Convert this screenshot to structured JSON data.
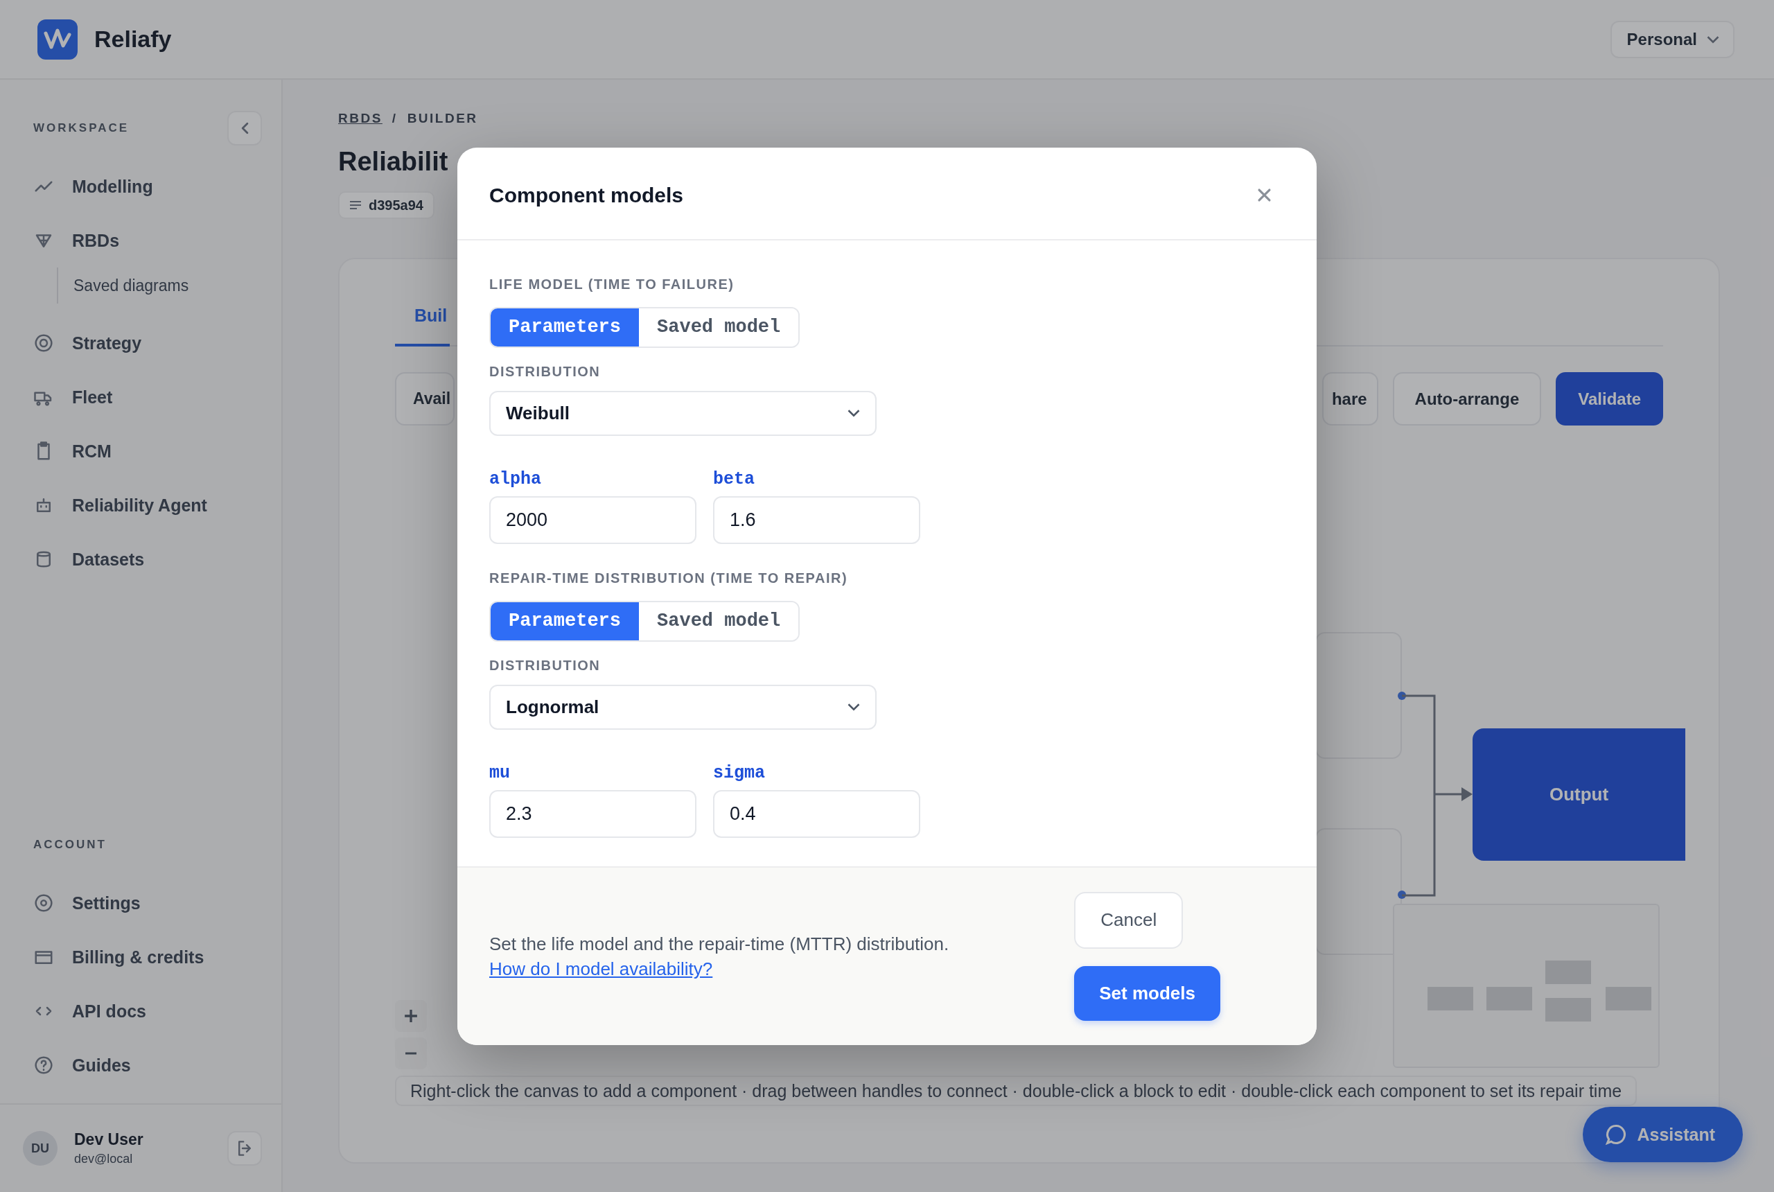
{
  "app": {
    "brand": "Reliafy",
    "workspace_switcher": "Personal",
    "sidebar": {
      "sections": [
        {
          "title": "WORKSPACE",
          "items": [
            {
              "label": "Modelling"
            },
            {
              "label": "RBDs",
              "children": [
                {
                  "label": "Saved diagrams"
                }
              ]
            },
            {
              "label": "Strategy"
            },
            {
              "label": "Fleet"
            },
            {
              "label": "RCM"
            },
            {
              "label": "Reliability Agent"
            },
            {
              "label": "Datasets"
            }
          ]
        },
        {
          "title": "ACCOUNT",
          "items": [
            {
              "label": "Settings"
            },
            {
              "label": "Billing & credits"
            },
            {
              "label": "API docs"
            },
            {
              "label": "Guides"
            }
          ]
        }
      ],
      "user": {
        "initials": "DU",
        "name": "Dev User",
        "email": "dev@local"
      }
    },
    "main": {
      "breadcrumb": {
        "items": [
          "RBDS",
          "BUILDER"
        ],
        "separator": "/"
      },
      "title": "Reliabilit",
      "id_chip": "d395a94",
      "tabs": [
        {
          "label": "Buil",
          "selected": true
        }
      ],
      "toolbar": {
        "left": [
          {
            "label": "Avail",
            "kind": "secondary"
          }
        ],
        "right": [
          {
            "label": "hare",
            "kind": "secondary"
          },
          {
            "label": "Auto-arrange",
            "kind": "secondary"
          },
          {
            "label": "Validate",
            "kind": "primary"
          }
        ]
      },
      "canvas": {
        "output_node": "Output",
        "hint": "Right-click the canvas to add a component · drag between handles to connect · double-click a block to edit · double-click each component to set its repair time"
      }
    },
    "assistant": "Assistant"
  },
  "modal": {
    "title": "Component models",
    "sections": [
      {
        "heading": "LIFE MODEL (TIME TO FAILURE)",
        "modes": [
          {
            "label": "Parameters",
            "selected": true
          },
          {
            "label": "Saved model",
            "selected": false
          }
        ],
        "distribution_label": "DISTRIBUTION",
        "distribution": "Weibull",
        "params": [
          {
            "name": "alpha",
            "value": "2000"
          },
          {
            "name": "beta",
            "value": "1.6"
          }
        ]
      },
      {
        "heading": "REPAIR-TIME DISTRIBUTION (TIME TO REPAIR)",
        "modes": [
          {
            "label": "Parameters",
            "selected": true
          },
          {
            "label": "Saved model",
            "selected": false
          }
        ],
        "distribution_label": "DISTRIBUTION",
        "distribution": "Lognormal",
        "params": [
          {
            "name": "mu",
            "value": "2.3"
          },
          {
            "name": "sigma",
            "value": "0.4"
          }
        ]
      }
    ],
    "footer": {
      "note": "Set the life model and the repair-time (MTTR) distribution.",
      "help_link": "How do I model availability?",
      "buttons": [
        {
          "label": "Cancel",
          "kind": "secondary"
        },
        {
          "label": "Set models",
          "kind": "primary"
        }
      ]
    }
  }
}
